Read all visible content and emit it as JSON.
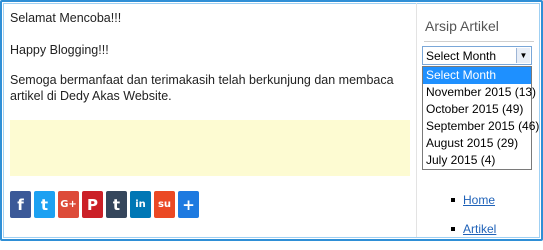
{
  "post": {
    "greeting": "Selamat Mencoba!!!",
    "signoff": "Happy Blogging!!!",
    "message": "Semoga bermanfaat dan terimakasih telah berkunjung dan membaca artikel di Dedy Akas Website."
  },
  "share": [
    {
      "icon": "facebook-icon",
      "glyph": "f",
      "color": "#3b5998"
    },
    {
      "icon": "twitter-icon",
      "glyph": "t",
      "color": "#1da1f2"
    },
    {
      "icon": "google-plus-icon",
      "glyph": "G+",
      "color": "#dd4b39"
    },
    {
      "icon": "pinterest-icon",
      "glyph": "P",
      "color": "#cb2027"
    },
    {
      "icon": "tumblr-icon",
      "glyph": "t",
      "color": "#35465c"
    },
    {
      "icon": "linkedin-icon",
      "glyph": "in",
      "color": "#0077b5"
    },
    {
      "icon": "stumbleupon-icon",
      "glyph": "su",
      "color": "#eb4924"
    },
    {
      "icon": "more-share-icon",
      "glyph": "+",
      "color": "#1e7ae0"
    }
  ],
  "sidebar": {
    "title": "Arsip Artikel",
    "select": {
      "value": "Select Month",
      "options": [
        "Select Month",
        "November 2015  (13)",
        "October 2015  (49)",
        "September 2015  (46)",
        "August 2015  (29)",
        "July 2015  (4)"
      ]
    },
    "nav": [
      "Home",
      "Artikel"
    ]
  }
}
